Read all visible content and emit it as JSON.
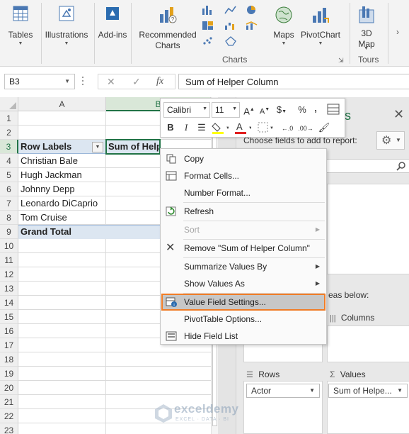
{
  "ribbon": {
    "tables": "Tables",
    "illustrations": "Illustrations",
    "addins": "Add-ins",
    "recommended_charts": "Recommended Charts",
    "maps": "Maps",
    "pivotchart": "PivotChart",
    "map3d": "3D Map",
    "charts_group": "Charts",
    "tours_group": "Tours"
  },
  "formula_bar": {
    "name_box": "B3",
    "cancel": "✕",
    "enter": "✓",
    "fx": "fx",
    "content": "Sum of Helper Column"
  },
  "sheet": {
    "columns": [
      "A",
      "B"
    ],
    "rows": [
      "1",
      "2",
      "3",
      "4",
      "5",
      "6",
      "7",
      "8",
      "9",
      "10",
      "11",
      "12",
      "13",
      "14",
      "15",
      "16",
      "17",
      "18",
      "19",
      "20",
      "21",
      "22",
      "23"
    ],
    "header_row_label": "Row Labels",
    "header_value_label": "Sum of Helper Column",
    "row_items": [
      "Christian Bale",
      "Hugh Jackman",
      "Johnny Depp",
      "Leonardo DiCaprio",
      "Tom Cruise"
    ],
    "grand_total": "Grand Total"
  },
  "mini_toolbar": {
    "font": "Calibri",
    "size": "11"
  },
  "context_menu": {
    "copy": "Copy",
    "format_cells": "Format Cells...",
    "number_format": "Number Format...",
    "refresh": "Refresh",
    "sort": "Sort",
    "remove": "Remove \"Sum of Helper Column\"",
    "summarize": "Summarize Values By",
    "show_values": "Show Values As",
    "value_field_settings": "Value Field Settings...",
    "pivot_options": "PivotTable Options...",
    "hide_field_list": "Hide Field List"
  },
  "field_pane": {
    "title": "s",
    "choose": "Choose fields to add to report:",
    "drag": "eas below:",
    "columns": "Columns",
    "rows": "Rows",
    "values": "Values",
    "rows_pill": "Actor",
    "values_pill": "Sum of Helpe..."
  },
  "watermark": {
    "name": "exceldemy",
    "tag": "EXCEL · DATA · BI"
  },
  "colors": {
    "excel_green": "#217346",
    "highlight_outline": "#f07c26",
    "pivot_band": "#dce6f1"
  }
}
